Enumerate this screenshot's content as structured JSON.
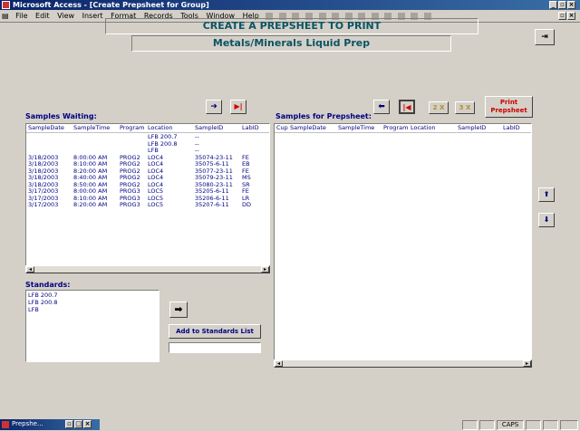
{
  "window": {
    "title": "Microsoft Access - [Create Prepsheet for Group]"
  },
  "menu": {
    "items": [
      "File",
      "Edit",
      "View",
      "Insert",
      "Format",
      "Records",
      "Tools",
      "Window",
      "Help"
    ]
  },
  "header": {
    "title": "CREATE A PREPSHEET TO PRINT",
    "subtitle": "Metals/Minerals Liquid Prep"
  },
  "samples_waiting": {
    "label": "Samples Waiting:",
    "columns": [
      "SampleDate",
      "SampleTime",
      "Program",
      "Location",
      "SampleID",
      "LabID"
    ],
    "rows": [
      [
        "",
        "",
        "",
        "LFB 200.7",
        "--",
        ""
      ],
      [
        "",
        "",
        "",
        "LFB 200.8",
        "--",
        ""
      ],
      [
        "",
        "",
        "",
        "LFB",
        "--",
        ""
      ],
      [
        "3/18/2003",
        "8:00:00 AM",
        "PROG2",
        "LOC4",
        "35074-23-11",
        "FE"
      ],
      [
        "3/18/2003",
        "8:10:00 AM",
        "PROG2",
        "LOC4",
        "35075-6-11",
        "EB"
      ],
      [
        "3/18/2003",
        "8:20:00 AM",
        "PROG2",
        "LOC4",
        "35077-23-11",
        "FE"
      ],
      [
        "3/18/2003",
        "8:40:00 AM",
        "PROG2",
        "LOC4",
        "35079-23-11",
        "MS"
      ],
      [
        "3/18/2003",
        "8:50:00 AM",
        "PROG2",
        "LOC4",
        "35080-23-11",
        "SR"
      ],
      [
        "3/17/2003",
        "8:00:00 AM",
        "PROG3",
        "LOC5",
        "35205-6-11",
        "FE"
      ],
      [
        "3/17/2003",
        "8:10:00 AM",
        "PROG3",
        "LOC5",
        "35206-6-11",
        "LR"
      ],
      [
        "3/17/2003",
        "8:20:00 AM",
        "PROG3",
        "LOC5",
        "35207-6-11",
        "DD"
      ]
    ]
  },
  "samples_prepsheet": {
    "label": "Samples for Prepsheet:",
    "columns": [
      "Cup",
      "SampleDate",
      "SampleTime",
      "Program",
      "Location",
      "SampleID",
      "LabID"
    ],
    "multiplier_2x": "2 X",
    "multiplier_3x": "3 X",
    "print_label": "Print Prepsheet"
  },
  "standards": {
    "label": "Standards:",
    "items": [
      "LFB 200.7",
      "LFB 200.8",
      "LFB"
    ],
    "add_button": "Add to Standards List",
    "add_value": ""
  },
  "statusbar": {
    "caps": "CAPS",
    "task_label": "Prepshe..."
  }
}
